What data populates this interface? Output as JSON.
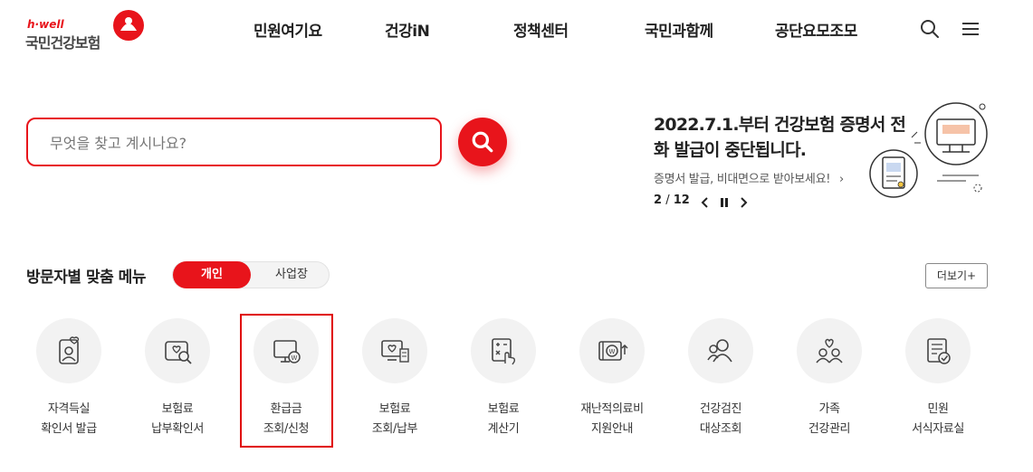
{
  "logo": {
    "brand": "h·well",
    "name": "국민건강보험"
  },
  "nav": {
    "items": [
      "민원여기요",
      "건강iN",
      "정책센터",
      "국민과함께",
      "공단요모조모"
    ],
    "icons": [
      "search-icon",
      "menu-icon"
    ]
  },
  "search": {
    "placeholder": "무엇을 찾고 계시나요?",
    "value": ""
  },
  "notice": {
    "title": "2022.7.1.부터 건강보험 증명서 전화 발급이 중단됩니다.",
    "subtitle": "증명서 발급, 비대면으로 받아보세요!",
    "page_current": "2",
    "page_total": "12"
  },
  "menu_section": {
    "title": "방문자별 맞춤 메뉴",
    "toggle_active": "개인",
    "toggle_inactive": "사업장",
    "more_label": "더보기+"
  },
  "menu_items": [
    {
      "line1": "자격득실",
      "line2": "확인서 발급",
      "icon": "id-card-heart-icon"
    },
    {
      "line1": "보험료",
      "line2": "납부확인서",
      "icon": "document-search-icon"
    },
    {
      "line1": "환급금",
      "line2": "조회/신청",
      "icon": "monitor-won-icon"
    },
    {
      "line1": "보험료",
      "line2": "조회/납부",
      "icon": "monitor-receipt-icon"
    },
    {
      "line1": "보험료",
      "line2": "계산기",
      "icon": "calculator-hand-icon"
    },
    {
      "line1": "재난적의료비",
      "line2": "지원안내",
      "icon": "wallet-won-icon"
    },
    {
      "line1": "건강검진",
      "line2": "대상조회",
      "icon": "people-search-icon"
    },
    {
      "line1": "가족",
      "line2": "건강관리",
      "icon": "family-heart-icon"
    },
    {
      "line1": "민원",
      "line2": "서식자료실",
      "icon": "form-check-icon"
    }
  ],
  "colors": {
    "accent": "#e8141b",
    "highlight_box": "#e00000"
  }
}
